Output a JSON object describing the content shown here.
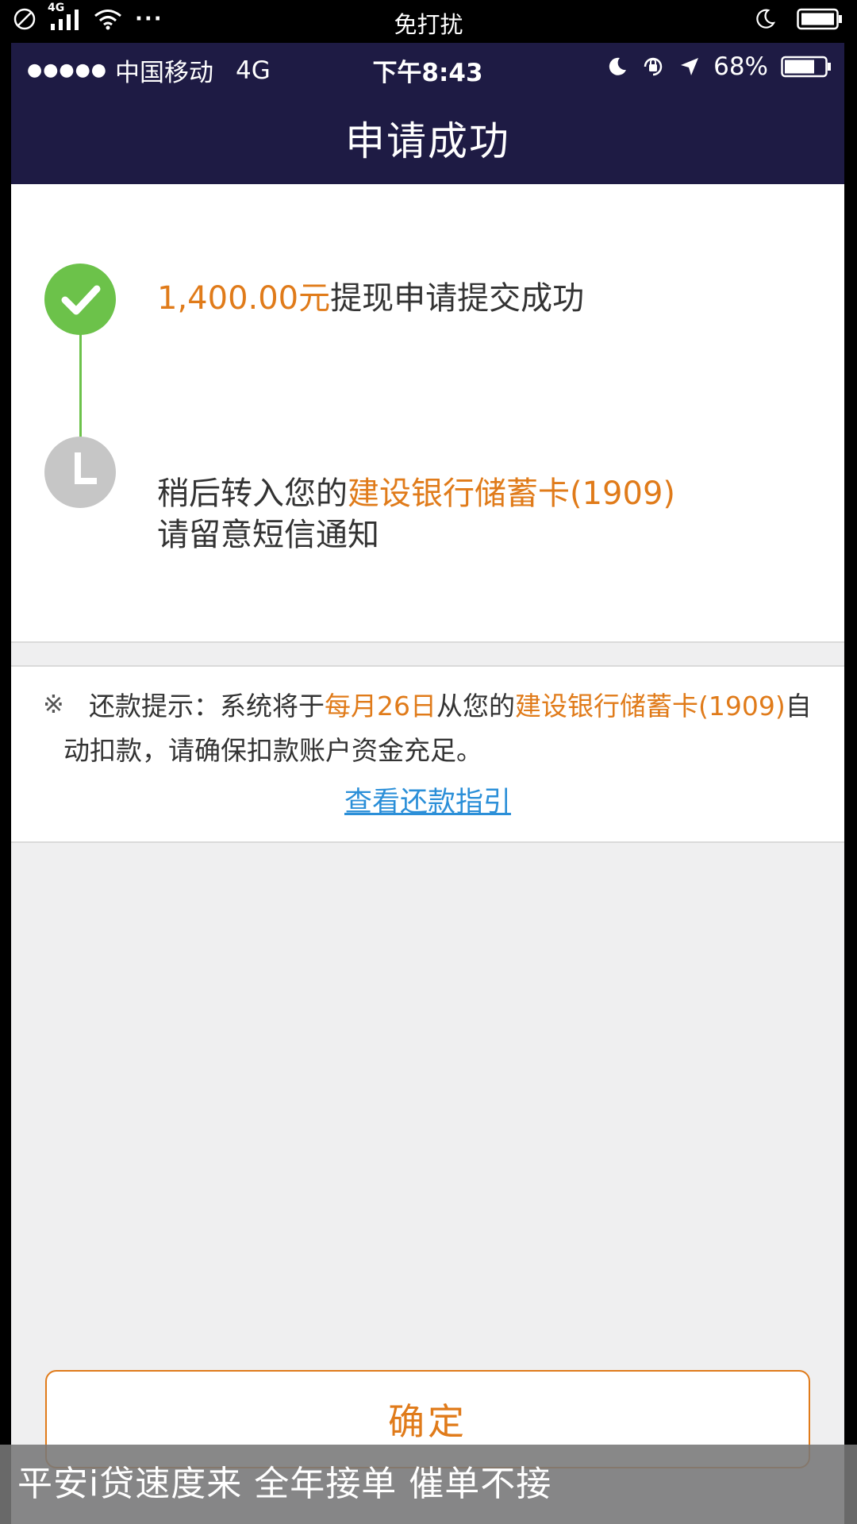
{
  "outer_status": {
    "network": "4G",
    "dots": "···",
    "center_label": "免打扰"
  },
  "ios_status": {
    "signal_dots": "●●●●●",
    "carrier": "中国移动",
    "network": "4G",
    "time": "下午8:43",
    "battery": "68%"
  },
  "header": {
    "title": "申请成功"
  },
  "steps": [
    {
      "state": "done",
      "amount": "1,400.00元",
      "text": "提现申请提交成功"
    },
    {
      "state": "pending",
      "prefix": "稍后转入您的",
      "bank": "建设银行储蓄卡(1909)",
      "line2": "请留意短信通知"
    }
  ],
  "tip": {
    "mark": "※",
    "label": "还款提示：系统将于",
    "date": "每月26日",
    "mid": "从您的",
    "bank": "建设银行储蓄卡(1909)",
    "tail": "自动扣款，请确保扣款账户资金充足。",
    "link": "查看还款指引"
  },
  "confirm_label": "确定",
  "caption": "平安i贷速度来 全年接单  催单不接",
  "colors": {
    "header_bg": "#1e1b44",
    "accent": "#e07b1a",
    "success": "#6cc24a",
    "link": "#2b8fd8"
  }
}
